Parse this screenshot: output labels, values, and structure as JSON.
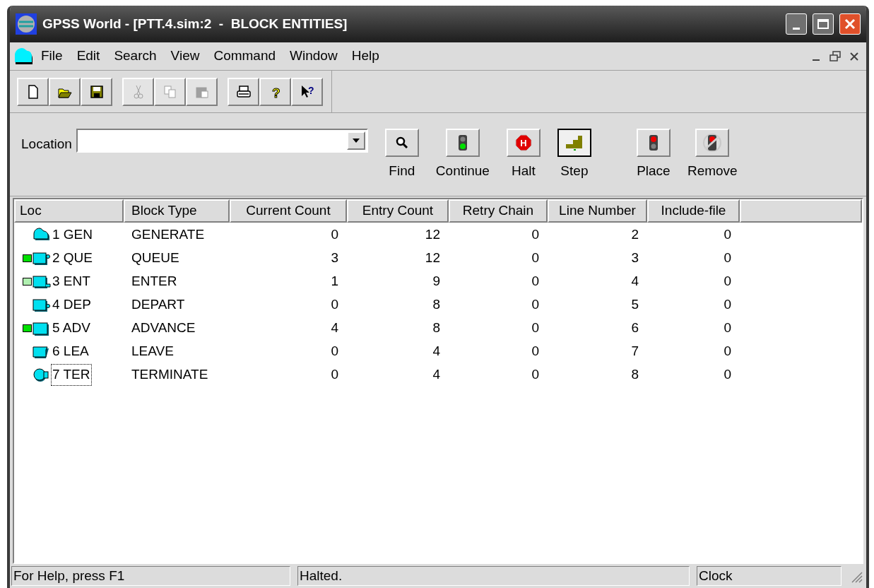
{
  "window": {
    "title": "GPSS World - [PTT.4.sim:2  -  BLOCK ENTITIES]"
  },
  "menu": [
    "File",
    "Edit",
    "Search",
    "View",
    "Command",
    "Window",
    "Help"
  ],
  "toolbar": [
    [
      {
        "kind": "new",
        "disabled": false
      },
      {
        "kind": "open",
        "disabled": false
      },
      {
        "kind": "save",
        "disabled": false
      }
    ],
    [
      {
        "kind": "cut",
        "disabled": true
      },
      {
        "kind": "copy",
        "disabled": true
      },
      {
        "kind": "paste",
        "disabled": true
      }
    ],
    [
      {
        "kind": "print",
        "disabled": false
      },
      {
        "kind": "help",
        "glyph": "?",
        "disabled": false
      },
      {
        "kind": "context-help",
        "glyph": "?",
        "disabled": false
      }
    ]
  ],
  "location": {
    "label": "Location"
  },
  "commands": [
    {
      "kind": "find",
      "label": "Find",
      "pressed": false
    },
    {
      "kind": "continue",
      "label": "Continue",
      "pressed": false
    },
    {
      "kind": "halt",
      "glyph": "H",
      "label": "Halt",
      "pressed": false
    },
    {
      "kind": "step",
      "label": "Step",
      "pressed": true
    },
    {
      "kind": "place",
      "label": "Place",
      "pressed": false
    },
    {
      "kind": "remove",
      "label": "Remove",
      "pressed": false
    }
  ],
  "table": {
    "columns": [
      "Loc",
      "Block Type",
      "Current Count",
      "Entry Count",
      "Retry Chain",
      "Line Number",
      "Include-file"
    ],
    "rows": [
      {
        "kind": "generate",
        "loc": "1 GEN",
        "block_type": "GENERATE",
        "current_count": "0",
        "entry_count": "12",
        "retry_chain": "0",
        "line_number": "2",
        "include_file": "0",
        "focused": false
      },
      {
        "kind": "queue",
        "color": "#00e000",
        "loc": "2 QUE",
        "block_type": "QUEUE",
        "current_count": "3",
        "entry_count": "12",
        "retry_chain": "0",
        "line_number": "3",
        "include_file": "0",
        "focused": false
      },
      {
        "kind": "enter",
        "color": "#b0f0b0",
        "loc": "3 ENT",
        "block_type": "ENTER",
        "current_count": "1",
        "entry_count": "9",
        "retry_chain": "0",
        "line_number": "4",
        "include_file": "0",
        "focused": false
      },
      {
        "kind": "depart",
        "loc": "4 DEP",
        "block_type": "DEPART",
        "current_count": "0",
        "entry_count": "8",
        "retry_chain": "0",
        "line_number": "5",
        "include_file": "0",
        "focused": false
      },
      {
        "kind": "advance",
        "color": "#00e000",
        "loc": "5 ADV",
        "block_type": "ADVANCE",
        "current_count": "4",
        "entry_count": "8",
        "retry_chain": "0",
        "line_number": "6",
        "include_file": "0",
        "focused": false
      },
      {
        "kind": "leave",
        "loc": "6 LEA",
        "block_type": "LEAVE",
        "current_count": "0",
        "entry_count": "4",
        "retry_chain": "0",
        "line_number": "7",
        "include_file": "0",
        "focused": false
      },
      {
        "kind": "terminate",
        "loc": "7 TER",
        "block_type": "TERMINATE",
        "current_count": "0",
        "entry_count": "4",
        "retry_chain": "0",
        "line_number": "8",
        "include_file": "0",
        "focused": true
      }
    ]
  },
  "status_bar": [
    "For Help, press F1",
    "Halted.",
    "Clock"
  ]
}
